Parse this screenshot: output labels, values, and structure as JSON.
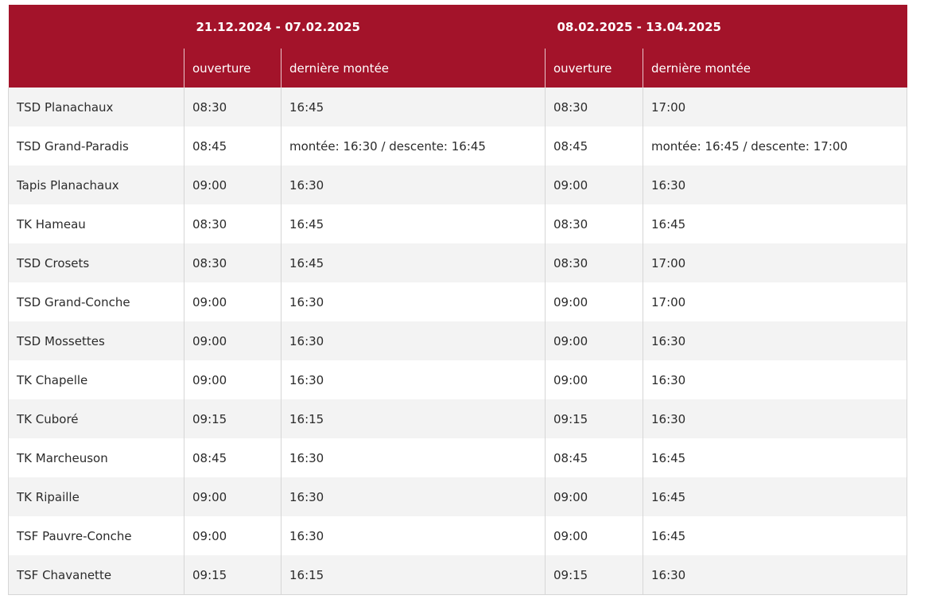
{
  "table": {
    "periods": [
      "21.12.2024 - 07.02.2025",
      "08.02.2025 - 13.04.2025"
    ],
    "sub_headers": {
      "opening": "ouverture",
      "last_ascent": "dernière montée"
    },
    "rows": [
      {
        "name": "TSD Planachaux",
        "o1": "08:30",
        "d1": "16:45",
        "o2": "08:30",
        "d2": "17:00"
      },
      {
        "name": "TSD Grand-Paradis",
        "o1": "08:45",
        "d1": "montée: 16:30 / descente: 16:45",
        "o2": "08:45",
        "d2": "montée: 16:45 / descente: 17:00"
      },
      {
        "name": "Tapis Planachaux",
        "o1": "09:00",
        "d1": "16:30",
        "o2": "09:00",
        "d2": "16:30"
      },
      {
        "name": "TK Hameau",
        "o1": "08:30",
        "d1": "16:45",
        "o2": "08:30",
        "d2": "16:45"
      },
      {
        "name": "TSD Crosets",
        "o1": "08:30",
        "d1": "16:45",
        "o2": "08:30",
        "d2": "17:00"
      },
      {
        "name": "TSD Grand-Conche",
        "o1": "09:00",
        "d1": "16:30",
        "o2": "09:00",
        "d2": "17:00"
      },
      {
        "name": "TSD Mossettes",
        "o1": "09:00",
        "d1": "16:30",
        "o2": "09:00",
        "d2": "16:30"
      },
      {
        "name": "TK Chapelle",
        "o1": "09:00",
        "d1": "16:30",
        "o2": "09:00",
        "d2": "16:30"
      },
      {
        "name": "TK Cuboré",
        "o1": "09:15",
        "d1": "16:15",
        "o2": "09:15",
        "d2": "16:30"
      },
      {
        "name": "TK Marcheuson",
        "o1": "08:45",
        "d1": "16:30",
        "o2": "08:45",
        "d2": "16:45"
      },
      {
        "name": "TK Ripaille",
        "o1": "09:00",
        "d1": "16:30",
        "o2": "09:00",
        "d2": "16:45"
      },
      {
        "name": "TSF Pauvre-Conche",
        "o1": "09:00",
        "d1": "16:30",
        "o2": "09:00",
        "d2": "16:45"
      },
      {
        "name": "TSF Chavanette",
        "o1": "09:15",
        "d1": "16:15",
        "o2": "09:15",
        "d2": "16:30"
      }
    ]
  },
  "colors": {
    "header_bg": "#a3132a",
    "header_text": "#ffffff",
    "row_alt_bg": "#f3f3f3"
  }
}
